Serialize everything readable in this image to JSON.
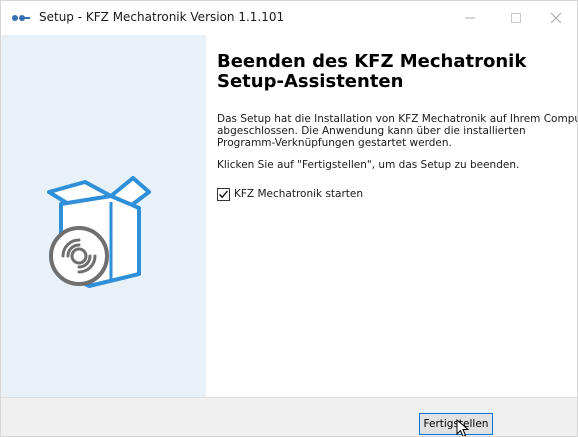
{
  "window": {
    "title": "Setup - KFZ Mechatronik Version 1.1.101",
    "controls": {
      "minimize": "—",
      "maximize": "☐",
      "close": "✕"
    }
  },
  "sidebar": {
    "image": "software-box-cd-icon"
  },
  "content": {
    "heading_line1": "Beenden des KFZ Mechatronik",
    "heading_line2": "Setup-Assistenten",
    "p1_line1": "Das Setup hat die Installation von KFZ Mechatronik auf Ihrem Computer",
    "p1_line2": "abgeschlossen. Die Anwendung kann über die installierten",
    "p1_line3": "Programm-Verknüpfungen gestartet werden.",
    "p2": "Klicken Sie auf \"Fertigstellen\", um das Setup zu beenden.",
    "checkbox_label": "KFZ Mechatronik starten",
    "checkbox_checked": true
  },
  "footer": {
    "finish_label": "Fertigstellen"
  },
  "colors": {
    "sidebar_bg": "#e9f1f8",
    "accent": "#0078d7",
    "icon_blue": "#2f8fd8"
  }
}
